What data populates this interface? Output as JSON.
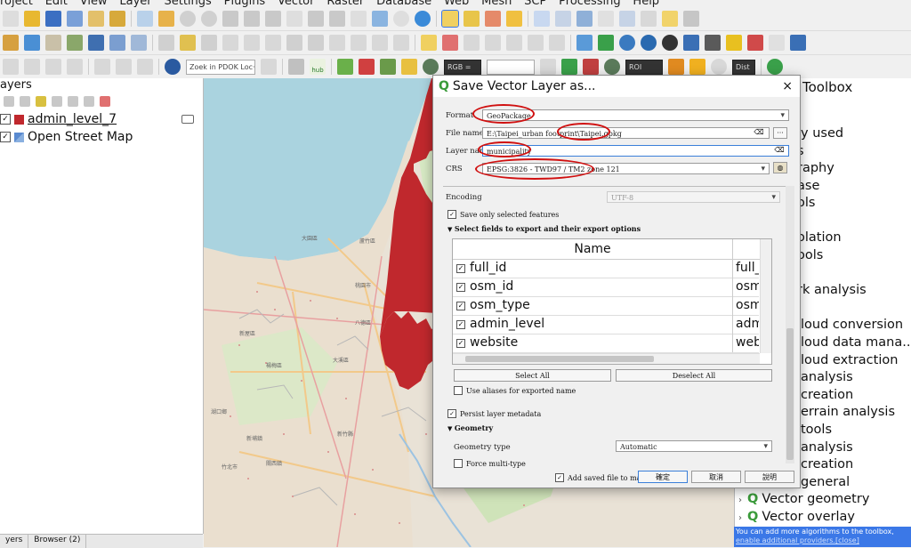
{
  "menu": [
    "roject",
    "Edit",
    "View",
    "Layer",
    "Settings",
    "Plugins",
    "Vector",
    "Raster",
    "Database",
    "Web",
    "Mesh",
    "SCP",
    "Processing",
    "Help"
  ],
  "toolbar": {
    "search_placeholder": "Zoek in PDOK Loc···",
    "hub_label": "hub",
    "rgb_label": "RGB =",
    "roi_label": "ROI",
    "dist_label": "Dist"
  },
  "layers_panel": {
    "title": "ayers",
    "layers": [
      {
        "name": "admin_level_7",
        "checked": true,
        "color": "#c0282d",
        "selected": true
      },
      {
        "name": "Open Street Map",
        "checked": true
      }
    ],
    "tabs": [
      "yers",
      "Browser (2)"
    ]
  },
  "toolbox": {
    "title": "Toolbox",
    "items": [
      "ly used",
      "s",
      "raphy",
      "ase",
      "ols",
      "olation",
      "ools",
      "rk analysis",
      "loud conversion",
      "loud data mana...",
      "loud extraction",
      "analysis",
      "creation",
      "errain analysis",
      "tools",
      "analysis",
      "creation",
      "general",
      "Vector geometry",
      "Vector overlay"
    ],
    "note_text": "You can add more algorithms to the toolbox, ",
    "note_link": "enable additional providers.",
    "note_close": "[close]"
  },
  "dialog": {
    "title": "Save Vector Layer as...",
    "close": "×",
    "format_label": "Format",
    "format_value": "GeoPackage",
    "filename_label": "File name",
    "filename_value": "E:\\Taipei_urban footprint\\Taipei.gpkg",
    "browse": "···",
    "layername_label": "Layer name",
    "layername_value": "municipality",
    "crs_label": "CRS",
    "crs_value": "EPSG:3826 - TWD97 / TM2 zone 121",
    "encoding_label": "Encoding",
    "encoding_value": "UTF-8",
    "save_selected": "Save only selected features",
    "fields_section": "Select fields to export and their export options",
    "fields_header": "Name",
    "fields": [
      {
        "name": "full_id",
        "alias": "full_i"
      },
      {
        "name": "osm_id",
        "alias": "osm_"
      },
      {
        "name": "osm_type",
        "alias": "osm_"
      },
      {
        "name": "admin_level",
        "alias": "admi"
      },
      {
        "name": "website",
        "alias": "webs"
      }
    ],
    "select_all": "Select All",
    "deselect_all": "Deselect All",
    "use_aliases": "Use aliases for exported name",
    "persist_metadata": "Persist layer metadata",
    "geometry_section": "Geometry",
    "geometry_type_label": "Geometry type",
    "geometry_type_value": "Automatic",
    "force_multi": "Force multi-type",
    "add_saved": "Add saved file to map",
    "ok": "確定",
    "cancel": "取消",
    "help": "說明"
  },
  "map_labels": [
    "大園區",
    "蘆竹區",
    "桃園市",
    "八德區",
    "大溪區",
    "新屋區",
    "楊梅區",
    "新竹縣",
    "關西鎮",
    "新埔鎮",
    "竹北市",
    "湖口鄉"
  ],
  "colors": {
    "layer_fill": "#c0282d",
    "accent": "#3b78e7",
    "annotation": "#d01010",
    "qgis_green": "#3a9b3a"
  }
}
